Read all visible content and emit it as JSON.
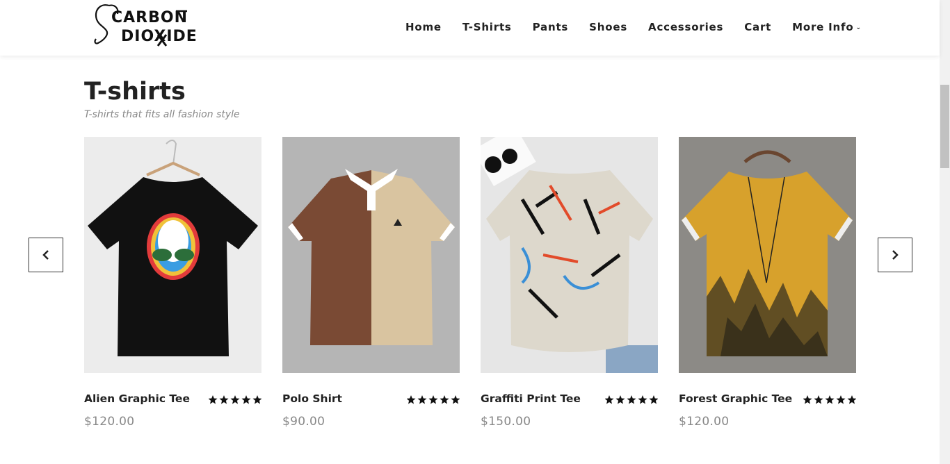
{
  "header": {
    "logo": {
      "line1": "CARBON",
      "line2": "DIOXIDE"
    },
    "nav": [
      {
        "label": "Home"
      },
      {
        "label": "T-Shirts"
      },
      {
        "label": "Pants"
      },
      {
        "label": "Shoes"
      },
      {
        "label": "Accessories"
      },
      {
        "label": "Cart"
      },
      {
        "label": "More Info"
      }
    ]
  },
  "section": {
    "title": "T-shirts",
    "subtitle": "T-shirts that fits all fashion style"
  },
  "products": [
    {
      "name": "Alien Graphic Tee",
      "price": "$120.00",
      "rating": 5,
      "image": "black t-shirt with rainbow alien head"
    },
    {
      "name": "Polo Shirt",
      "price": "$90.00",
      "rating": 5,
      "image": "brown and beige color-block polo"
    },
    {
      "name": "Graffiti Print Tee",
      "price": "$150.00",
      "rating": 5,
      "image": "white tee with graffiti print"
    },
    {
      "name": "Forest Graphic Tee",
      "price": "$120.00",
      "rating": 5,
      "image": "mustard tee with forest print"
    }
  ],
  "icons": {
    "prev": "chevron-left-icon",
    "next": "chevron-right-icon",
    "dropdown": "chevron-down-icon",
    "star": "star-icon"
  },
  "colors": {
    "text": "#222222",
    "muted": "#888888",
    "star": "#111111"
  }
}
